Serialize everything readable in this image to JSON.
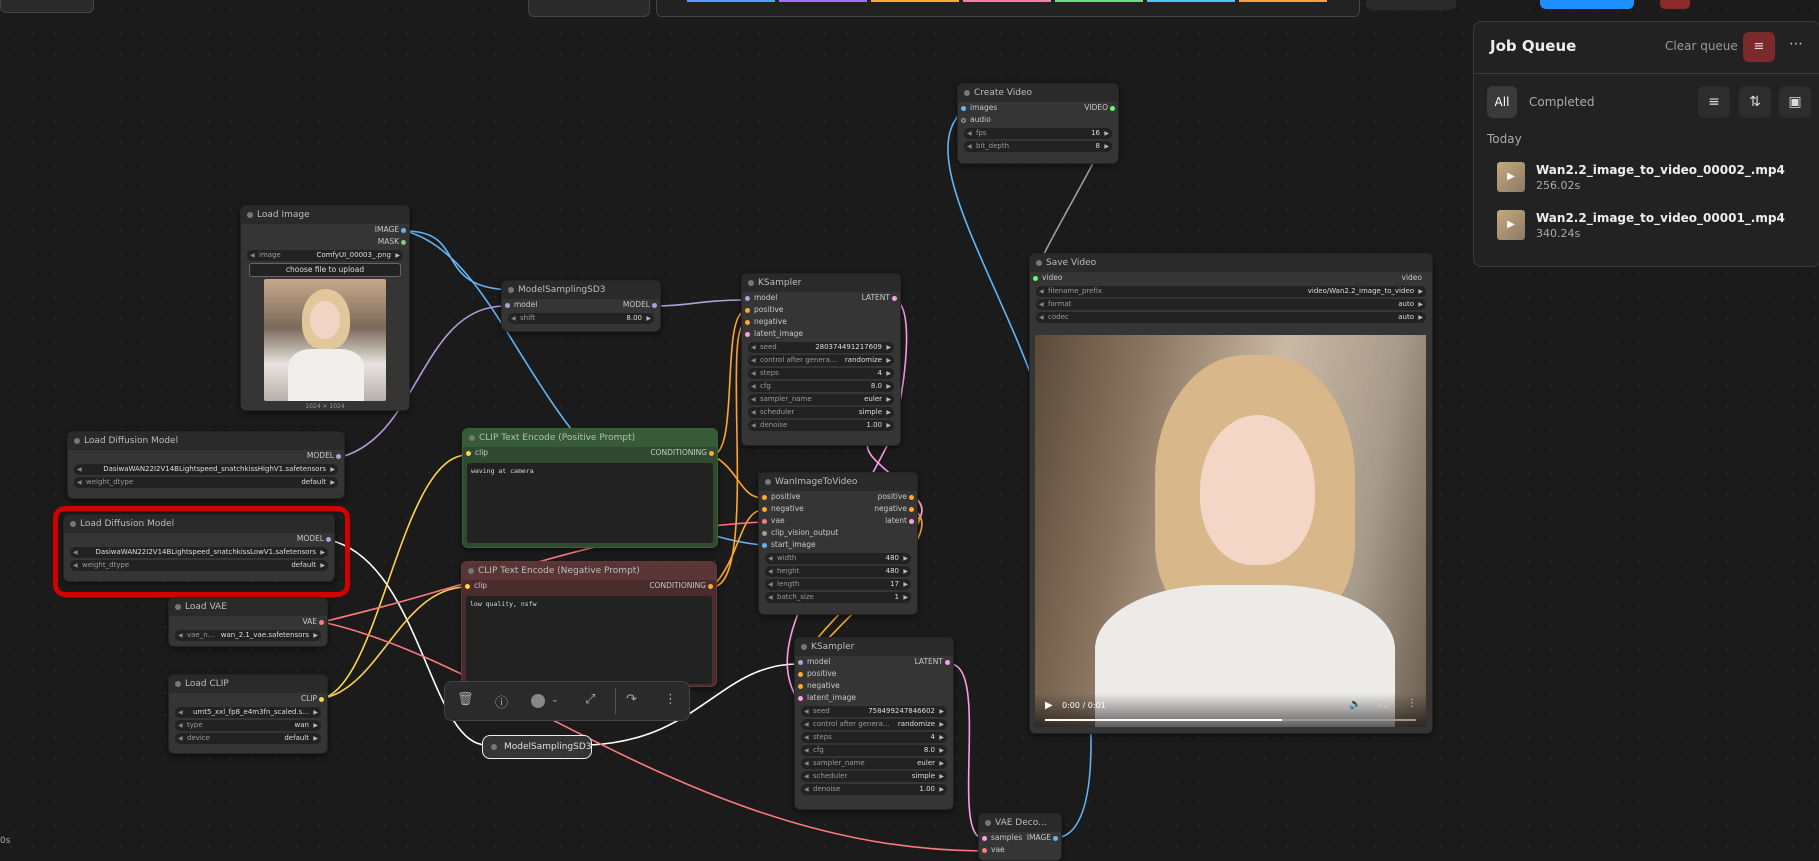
{
  "nodes": {
    "load_image": {
      "title": "Load Image",
      "out_image": "IMAGE",
      "out_mask": "MASK",
      "image_label": "image",
      "image_value": "ComfyUI_00003_.png",
      "upload": "choose file to upload",
      "dims": "1024 × 1024"
    },
    "load_diff_high": {
      "title": "Load Diffusion Model",
      "out_model": "MODEL",
      "unet_value": "DasiwaWAN22I2V14BLightspeed_snatchkissHighV1.safetensors",
      "dtype_label": "weight_dtype",
      "dtype_value": "default"
    },
    "load_diff_low": {
      "title": "Load Diffusion Model",
      "out_model": "MODEL",
      "unet_value": "DasiwaWAN22I2V14BLightspeed_snatchkissLowV1.safetensors",
      "dtype_label": "weight_dtype",
      "dtype_value": "default"
    },
    "load_vae": {
      "title": "Load VAE",
      "out": "VAE",
      "label": "vae_n...",
      "value": "wan_2.1_vae.safetensors"
    },
    "load_clip": {
      "title": "Load CLIP",
      "out": "CLIP",
      "name_value": "umt5_xxl_fp8_e4m3fn_scaled.s...",
      "type_label": "type",
      "type_value": "wan",
      "device_label": "device",
      "device_value": "default"
    },
    "msd3_top": {
      "title": "ModelSamplingSD3",
      "in_model": "model",
      "out_model": "MODEL",
      "shift_label": "shift",
      "shift_value": "8.00"
    },
    "msd3_bottom": {
      "title": "ModelSamplingSD3"
    },
    "clip_pos": {
      "title": "CLIP Text Encode (Positive Prompt)",
      "in_clip": "clip",
      "out": "CONDITIONING",
      "text": "waving at camera"
    },
    "clip_neg": {
      "title": "CLIP Text Encode (Negative Prompt)",
      "in_clip": "clip",
      "out": "CONDITIONING",
      "text": "low quality, nsfw"
    },
    "ksampler1": {
      "title": "KSampler",
      "inputs": [
        "model",
        "positive",
        "negative",
        "latent_image"
      ],
      "out": "LATENT",
      "widgets": [
        [
          "seed",
          "280374491217609"
        ],
        [
          "control after genera...",
          "randomize"
        ],
        [
          "steps",
          "4"
        ],
        [
          "cfg",
          "8.0"
        ],
        [
          "sampler_name",
          "euler"
        ],
        [
          "scheduler",
          "simple"
        ],
        [
          "denoise",
          "1.00"
        ]
      ]
    },
    "wan_i2v": {
      "title": "WanImageToVideo",
      "inputs": [
        "positive",
        "negative",
        "vae",
        "clip_vision_output",
        "start_image"
      ],
      "outputs": [
        "positive",
        "negative",
        "latent"
      ],
      "widgets": [
        [
          "width",
          "480"
        ],
        [
          "height",
          "480"
        ],
        [
          "length",
          "17"
        ],
        [
          "batch_size",
          "1"
        ]
      ]
    },
    "ksampler2": {
      "title": "KSampler",
      "inputs": [
        "model",
        "positive",
        "negative",
        "latent_image"
      ],
      "out": "LATENT",
      "widgets": [
        [
          "seed",
          "758499247846602"
        ],
        [
          "control after genera...",
          "randomize"
        ],
        [
          "steps",
          "4"
        ],
        [
          "cfg",
          "8.0"
        ],
        [
          "sampler_name",
          "euler"
        ],
        [
          "scheduler",
          "simple"
        ],
        [
          "denoise",
          "1.00"
        ]
      ]
    },
    "create_video": {
      "title": "Create Video",
      "in_images": "images",
      "in_audio": "audio",
      "out": "VIDEO",
      "fps_label": "fps",
      "fps_value": "16",
      "bit_label": "bit_depth",
      "bit_value": "8"
    },
    "save_video": {
      "title": "Save Video",
      "in_video": "video",
      "out_video": "video",
      "prefix_label": "filename_prefix",
      "prefix_value": "video/Wan2.2_image_to_video",
      "format_label": "format",
      "format_value": "auto",
      "codec_label": "codec",
      "codec_value": "auto",
      "time": "0:00 / 0:01"
    },
    "vae_decode": {
      "title": "VAE Deco...",
      "in_samples": "samples",
      "in_vae": "vae",
      "out": "IMAGE"
    }
  },
  "job_queue": {
    "title": "Job Queue",
    "clear": "Clear queue",
    "tab_all": "All",
    "tab_completed": "Completed",
    "section": "Today",
    "items": [
      {
        "name": "Wan2.2_image_to_video_00002_.mp4",
        "time": "256.02s"
      },
      {
        "name": "Wan2.2_image_to_video_00001_.mp4",
        "time": "340.24s"
      }
    ]
  },
  "corner_text": "0s",
  "colors": {
    "model": "#b39ddb",
    "clip": "#ffd54f",
    "vae": "#ff7a7a",
    "image": "#64b5f6",
    "latent": "#ff9ce6",
    "conditioning": "#ffa931",
    "video": "#66ff66",
    "selected": "#e00000"
  }
}
